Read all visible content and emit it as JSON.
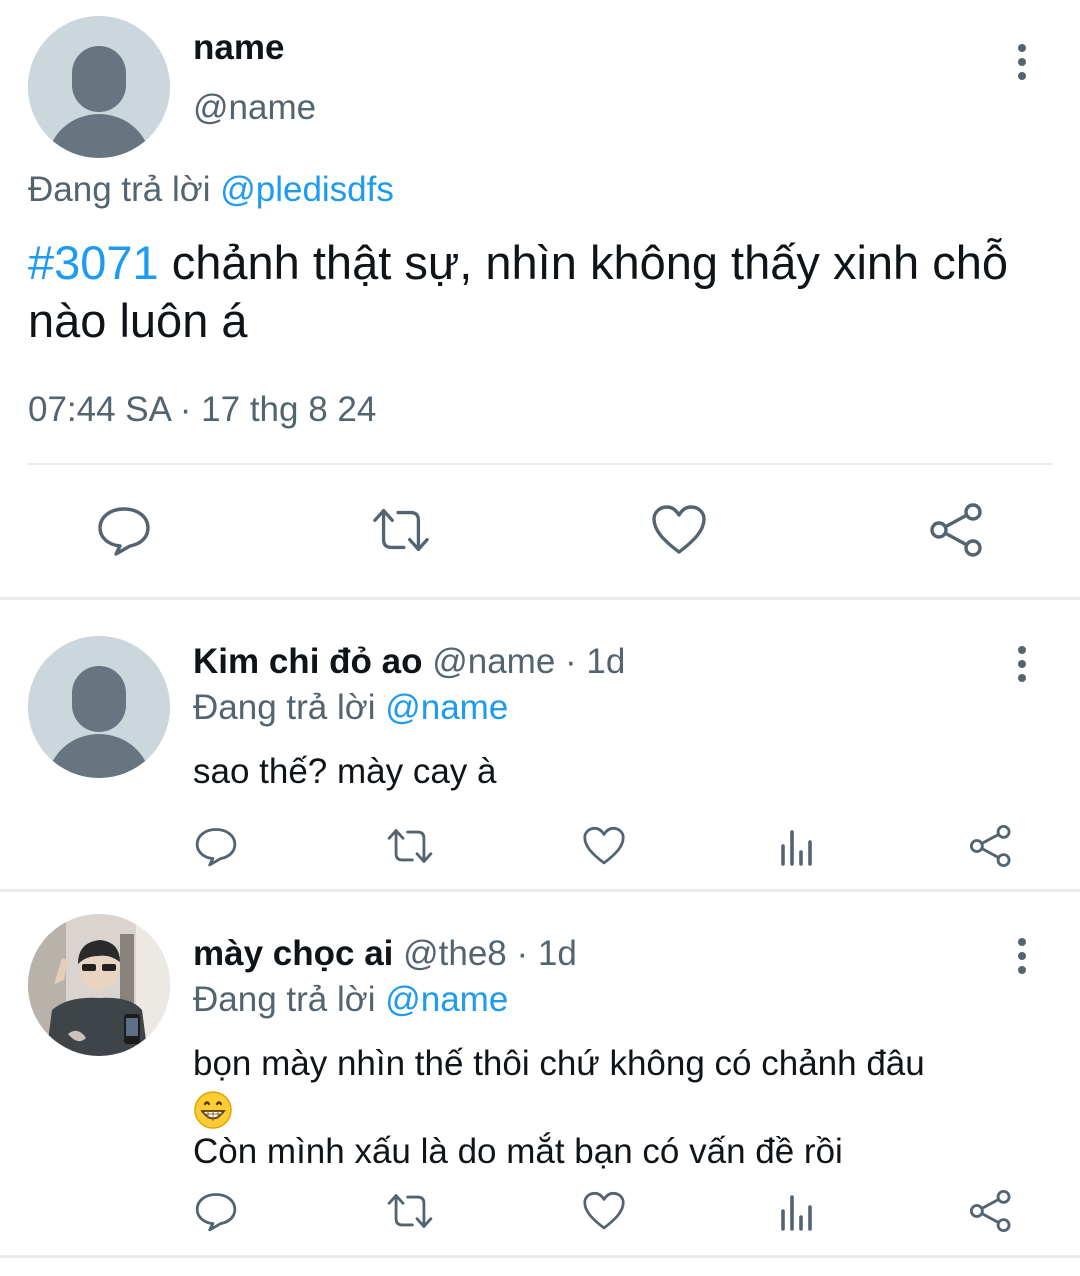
{
  "main_tweet": {
    "author_name": "name",
    "author_handle": "@name",
    "reply_prefix": "Đang trả lời",
    "reply_target": "@pledisdfs",
    "hashtag": "#3071",
    "text": " chảnh thật sự, nhìn không thấy xinh chỗ nào luôn á",
    "timestamp": "07:44 SA · 17 thg 8 24",
    "actions": [
      "reply-icon",
      "retweet-icon",
      "like-icon",
      "share-icon"
    ]
  },
  "replies": [
    {
      "name": "Kim chi đỏ ao",
      "handle": "@name",
      "time": "· 1d",
      "reply_prefix": "Đang trả lời",
      "reply_target": "@name",
      "text": "sao thế? mày cay à",
      "actions": [
        "reply-icon",
        "retweet-icon",
        "like-icon",
        "views-icon",
        "share-icon"
      ]
    },
    {
      "name": "mày chọc ai",
      "handle": "@the8",
      "time": "· 1d",
      "reply_prefix": "Đang trả lời",
      "reply_target": "@name",
      "text_line1": "bọn mày nhìn thế thôi chứ không có chảnh đâu",
      "emoji": "grinning-face-emoji",
      "text_line2": "Còn mình xấu là do mắt bạn có vấn đề rồi",
      "actions": [
        "reply-icon",
        "retweet-icon",
        "like-icon",
        "views-icon",
        "share-icon"
      ]
    }
  ],
  "colors": {
    "link": "#1d9bf0",
    "secondary_text": "#536471",
    "icon": "#536471",
    "divider": "#e7e9ea",
    "avatar_placeholder": "#ccd6dd"
  }
}
